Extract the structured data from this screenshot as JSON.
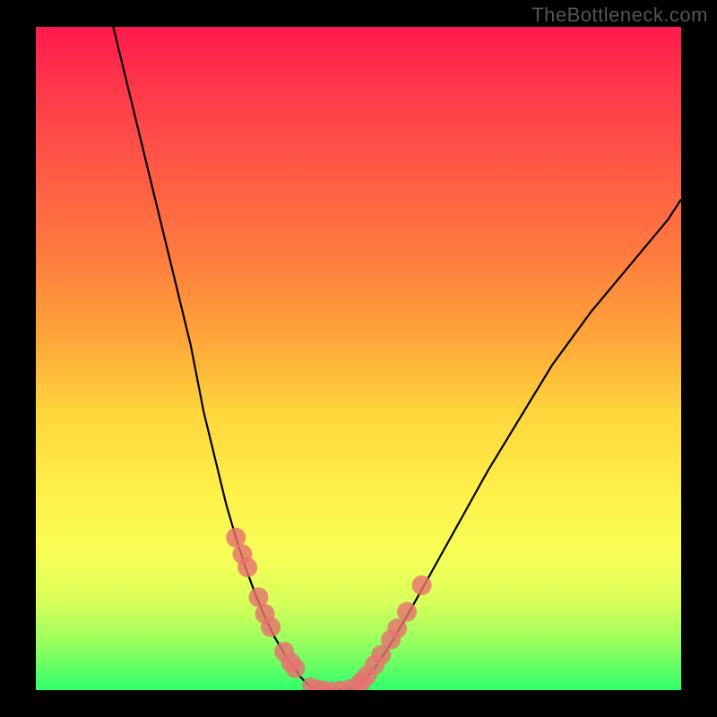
{
  "watermark": "TheBottleneck.com",
  "colors": {
    "frame": "#000000",
    "curve": "#000000",
    "dot": "#e6736f",
    "gradient_stops": [
      "#ff1a4d",
      "#ff3a4a",
      "#ff5b46",
      "#ff7a3f",
      "#ffa23a",
      "#ffd53c",
      "#fff04a",
      "#f6ff56",
      "#d6ff5a",
      "#96ff5e",
      "#2fff6c"
    ]
  },
  "chart_data": {
    "type": "line",
    "title": "",
    "xlabel": "",
    "ylabel": "",
    "xlim": [
      0,
      100
    ],
    "ylim": [
      0,
      100
    ],
    "note": "Axes are unlabeled; values estimated from pixel positions (0–100 normalized).",
    "series": [
      {
        "name": "left-curve",
        "x": [
          12,
          15,
          18,
          21,
          24,
          26,
          28,
          29.5,
          31,
          32.5,
          34,
          35.5,
          37,
          38.5,
          40,
          41,
          42,
          42.8
        ],
        "y": [
          100,
          88,
          76,
          64,
          52,
          42,
          34,
          28,
          23,
          18.5,
          14.5,
          11,
          8,
          5.5,
          3.5,
          2,
          1,
          0.4
        ]
      },
      {
        "name": "valley-floor",
        "x": [
          42.8,
          44,
          45,
          46,
          47,
          48,
          49,
          49.8
        ],
        "y": [
          0.4,
          0.1,
          0.05,
          0.03,
          0.05,
          0.1,
          0.25,
          0.5
        ]
      },
      {
        "name": "right-curve",
        "x": [
          49.8,
          51,
          53,
          55,
          58,
          62,
          66,
          70,
          75,
          80,
          86,
          92,
          98,
          100
        ],
        "y": [
          0.5,
          1.5,
          4,
          7,
          12,
          19,
          26,
          33,
          41,
          49,
          57,
          64,
          71,
          74
        ]
      }
    ],
    "scatter": [
      {
        "name": "left-dots",
        "points": [
          {
            "x": 31.0,
            "y": 23.0
          },
          {
            "x": 32.0,
            "y": 20.5
          },
          {
            "x": 32.8,
            "y": 18.5
          },
          {
            "x": 34.5,
            "y": 14.0
          },
          {
            "x": 35.5,
            "y": 11.5
          },
          {
            "x": 36.4,
            "y": 9.5
          },
          {
            "x": 38.5,
            "y": 5.8
          },
          {
            "x": 39.5,
            "y": 4.2
          },
          {
            "x": 40.2,
            "y": 3.3
          }
        ],
        "r": 11
      },
      {
        "name": "valley-dots",
        "points": [
          {
            "x": 42.5,
            "y": 0.7
          },
          {
            "x": 43.5,
            "y": 0.4
          },
          {
            "x": 44.5,
            "y": 0.2
          },
          {
            "x": 45.8,
            "y": 0.1
          },
          {
            "x": 47.2,
            "y": 0.2
          },
          {
            "x": 48.6,
            "y": 0.4
          },
          {
            "x": 49.8,
            "y": 0.8
          }
        ],
        "r": 9
      },
      {
        "name": "right-dots",
        "points": [
          {
            "x": 50.5,
            "y": 1.3
          },
          {
            "x": 51.3,
            "y": 2.2
          },
          {
            "x": 52.5,
            "y": 3.8
          },
          {
            "x": 53.5,
            "y": 5.3
          },
          {
            "x": 55.0,
            "y": 7.6
          },
          {
            "x": 56.0,
            "y": 9.3
          },
          {
            "x": 57.5,
            "y": 11.8
          },
          {
            "x": 59.8,
            "y": 15.8
          }
        ],
        "r": 11
      }
    ]
  }
}
